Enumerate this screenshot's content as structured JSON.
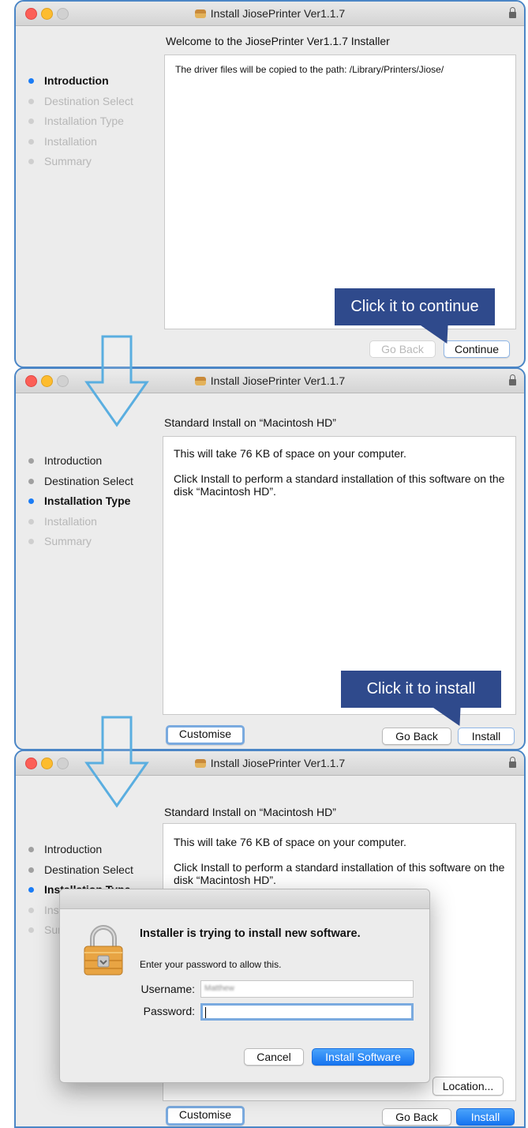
{
  "window_title": "Install JiosePrinter Ver1.1.7",
  "steps": [
    "Introduction",
    "Destination Select",
    "Installation Type",
    "Installation",
    "Summary"
  ],
  "panel1": {
    "heading": "Welcome to the JiosePrinter Ver1.1.7 Installer",
    "body": "The driver files will be copied to the path: /Library/Printers/Jiose/",
    "go_back": "Go Back",
    "continue": "Continue",
    "callout": "Click it to continue"
  },
  "panel2": {
    "heading": "Standard Install on “Macintosh HD”",
    "space_text": "This will take 76 KB of space on your computer.",
    "install_text": "Click Install to perform a standard installation of this software on the disk “Macintosh HD”.",
    "customise": "Customise",
    "go_back": "Go Back",
    "install": "Install",
    "callout": "Click it to install"
  },
  "panel3": {
    "heading": "Standard Install on “Macintosh HD”",
    "space_text": "This will take 76 KB of space on your computer.",
    "install_text": "Click Install to perform a standard installation of this software on the disk “Macintosh HD”.",
    "location": "Location...",
    "customise": "Customise",
    "go_back": "Go Back",
    "install": "Install"
  },
  "auth_dialog": {
    "title": "Installer is trying to install new software.",
    "message": "Enter your password to allow this.",
    "username_label": "Username:",
    "username_value": "Matthew",
    "password_label": "Password:",
    "password_value": "",
    "cancel": "Cancel",
    "install_software": "Install Software"
  },
  "colors": {
    "window_border": "#4b86c6",
    "callout": "#2f4a8c",
    "active_step": "#1a7cf6",
    "flow_arrow": "#5aaee0"
  }
}
